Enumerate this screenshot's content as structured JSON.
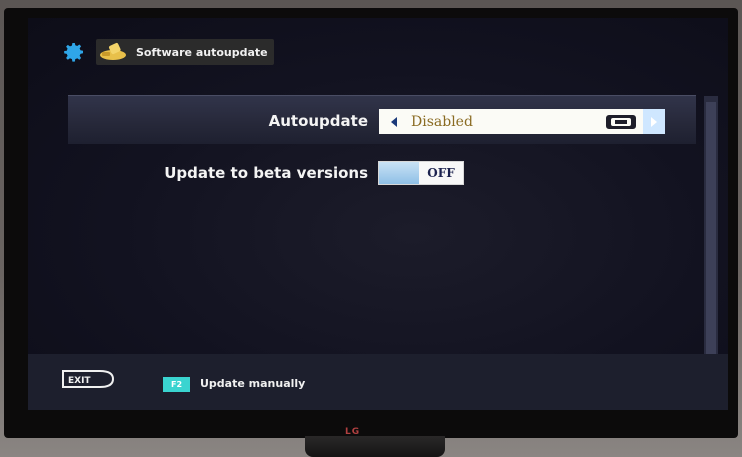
{
  "header": {
    "title": "Software autoupdate",
    "icons": [
      "gear-icon",
      "tool-icon"
    ]
  },
  "settings": [
    {
      "label": "Autoupdate",
      "value": "Disabled"
    },
    {
      "label": "Update to beta versions",
      "value": "OFF"
    }
  ],
  "footer": {
    "exit_label": "EXIT",
    "f2_key": "F2",
    "f2_action": "Update manually"
  },
  "tv": {
    "brand": "LG"
  },
  "colors": {
    "highlight_row": "#2a2c40",
    "select_value": "#8a6b22",
    "f2_badge": "#3ad4d0",
    "toggle_on_part": "#9cc8ea"
  }
}
